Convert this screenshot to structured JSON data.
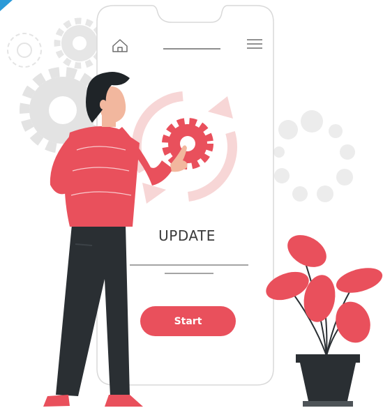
{
  "screen": {
    "title": "UPDATE",
    "start_button_label": "Start"
  },
  "icons": {
    "home": "home-icon",
    "menu": "hamburger-menu-icon",
    "gear": "gear-icon",
    "refresh": "refresh-arrows-icon"
  },
  "colors": {
    "accent": "#e9505c",
    "pants": "#2a2f33",
    "phone_outline": "#d9d9d9",
    "gear_gray": "#e3e3e3",
    "accent_light": "#f9dcdc"
  }
}
